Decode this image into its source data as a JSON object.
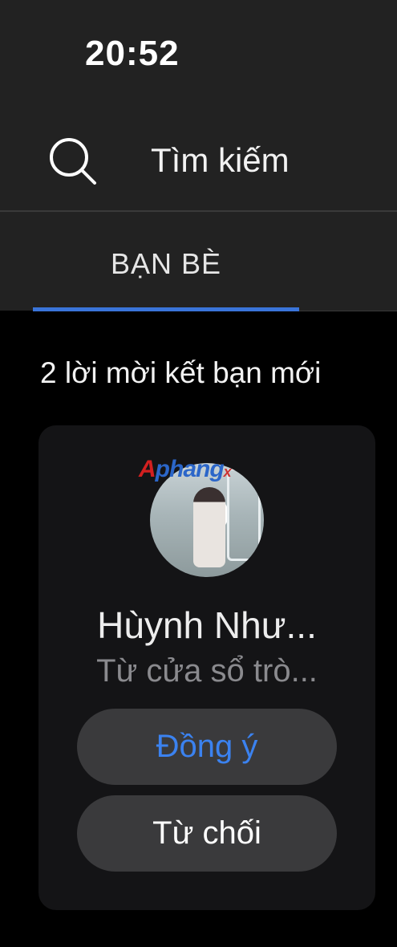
{
  "status_bar": {
    "time": "20:52"
  },
  "search": {
    "label": "Tìm kiếm"
  },
  "tabs": [
    {
      "label": "BẠN BÈ",
      "active": true
    }
  ],
  "section": {
    "title": "2 lời mời kết bạn mới"
  },
  "request_card": {
    "watermark": {
      "part1": "A",
      "part2": "phang",
      "part3": "x"
    },
    "name": "Hùynh Như...",
    "subtitle": "Từ cửa sổ trò...",
    "accept_label": "Đồng ý",
    "decline_label": "Từ chối"
  },
  "colors": {
    "accent": "#3a74d9",
    "accept_text": "#3b82f0",
    "header_bg": "#222222",
    "card_bg": "#141416",
    "button_bg": "#3a3a3c"
  }
}
